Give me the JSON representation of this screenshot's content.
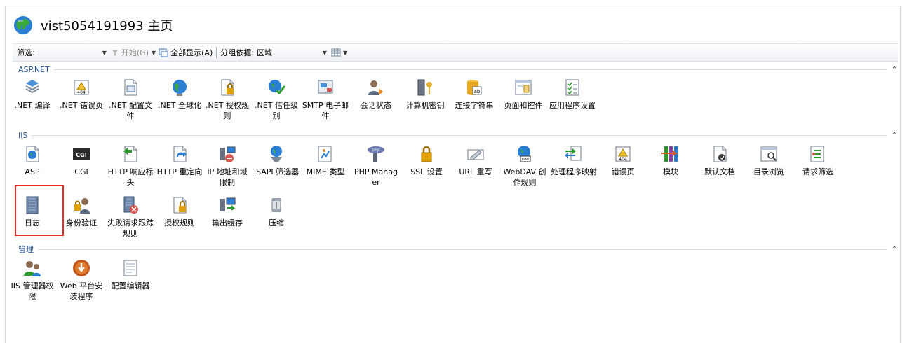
{
  "header": {
    "title": "vist5054191993 主页",
    "icon": "globe-icon"
  },
  "toolbar": {
    "filter_label": "筛选:",
    "filter_value": "",
    "start_label": "开始(G)",
    "show_all_label": "全部显示(A)",
    "group_by_label": "分组依据:",
    "group_by_value": "区域"
  },
  "sections": [
    {
      "title": "ASP.NET",
      "items": [
        {
          "label": ".NET 编译",
          "icon": "compile-icon"
        },
        {
          "label": ".NET 错误页",
          "icon": "error-page-icon"
        },
        {
          "label": ".NET 配置文件",
          "icon": "profile-icon"
        },
        {
          "label": ".NET 全球化",
          "icon": "globe-icon"
        },
        {
          "label": ".NET 授权规则",
          "icon": "lock-icon"
        },
        {
          "label": ".NET 信任级别",
          "icon": "trust-icon"
        },
        {
          "label": "SMTP 电子邮件",
          "icon": "mail-icon"
        },
        {
          "label": "会话状态",
          "icon": "session-icon"
        },
        {
          "label": "计算机密钥",
          "icon": "machine-key-icon"
        },
        {
          "label": "连接字符串",
          "icon": "database-icon"
        },
        {
          "label": "页面和控件",
          "icon": "page-icon"
        },
        {
          "label": "应用程序设置",
          "icon": "settings-list-icon"
        }
      ]
    },
    {
      "title": "IIS",
      "items": [
        {
          "label": "ASP",
          "icon": "asp-icon"
        },
        {
          "label": "CGI",
          "icon": "cgi-icon"
        },
        {
          "label": "HTTP 响应标头",
          "icon": "http-header-icon"
        },
        {
          "label": "HTTP 重定向",
          "icon": "redirect-icon"
        },
        {
          "label": "IP 地址和域限制",
          "icon": "ip-restrict-icon"
        },
        {
          "label": "ISAPI 筛选器",
          "icon": "isapi-icon"
        },
        {
          "label": "MIME 类型",
          "icon": "mime-icon"
        },
        {
          "label": "PHP Manager",
          "icon": "php-icon"
        },
        {
          "label": "SSL 设置",
          "icon": "padlock-icon"
        },
        {
          "label": "URL 重写",
          "icon": "url-rewrite-icon"
        },
        {
          "label": "WebDAV 创作规则",
          "icon": "webdav-icon"
        },
        {
          "label": "处理程序映射",
          "icon": "handler-icon"
        },
        {
          "label": "错误页",
          "icon": "error-page-icon"
        },
        {
          "label": "模块",
          "icon": "modules-icon"
        },
        {
          "label": "默认文档",
          "icon": "default-doc-icon"
        },
        {
          "label": "目录浏览",
          "icon": "directory-icon"
        },
        {
          "label": "请求筛选",
          "icon": "request-filter-icon"
        },
        {
          "label": "日志",
          "icon": "log-icon"
        },
        {
          "label": "身份验证",
          "icon": "auth-icon"
        },
        {
          "label": "失败请求跟踪规则",
          "icon": "failed-trace-icon"
        },
        {
          "label": "授权规则",
          "icon": "lock-icon"
        },
        {
          "label": "输出缓存",
          "icon": "output-cache-icon"
        },
        {
          "label": "压缩",
          "icon": "compress-icon"
        }
      ]
    },
    {
      "title": "管理",
      "items": [
        {
          "label": "IIS 管理器权限",
          "icon": "users-icon"
        },
        {
          "label": "Web 平台安装程序",
          "icon": "install-icon"
        },
        {
          "label": "配置编辑器",
          "icon": "config-editor-icon"
        }
      ]
    }
  ]
}
